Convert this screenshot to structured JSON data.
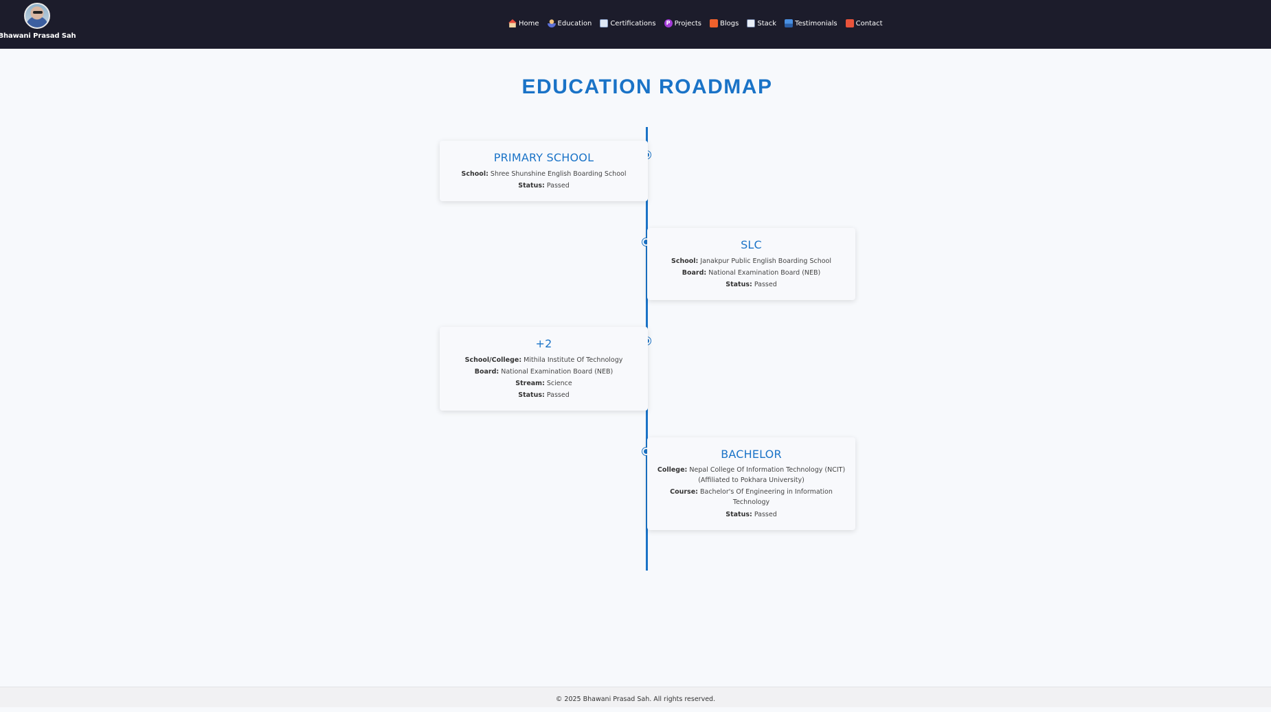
{
  "header": {
    "name": "Bhawani Prasad Sah",
    "nav": [
      {
        "label": "Home",
        "icon": "home-icon"
      },
      {
        "label": "Education",
        "icon": "education-icon"
      },
      {
        "label": "Certifications",
        "icon": "certificate-icon"
      },
      {
        "label": "Projects",
        "icon": "projects-icon"
      },
      {
        "label": "Blogs",
        "icon": "blogs-icon"
      },
      {
        "label": "Stack",
        "icon": "stack-icon"
      },
      {
        "label": "Testimonials",
        "icon": "testimonials-icon"
      },
      {
        "label": "Contact",
        "icon": "contact-icon"
      }
    ]
  },
  "main": {
    "title": "EDUCATION ROADMAP",
    "cards": [
      {
        "title": "PRIMARY SCHOOL",
        "lines": [
          {
            "label": "School:",
            "value": "Shree Shunshine English Boarding School"
          },
          {
            "label": "Status:",
            "value": "Passed"
          }
        ]
      },
      {
        "title": "SLC",
        "lines": [
          {
            "label": "School:",
            "value": "Janakpur Public English Boarding School"
          },
          {
            "label": "Board:",
            "value": "National Examination Board (NEB)"
          },
          {
            "label": "Status:",
            "value": "Passed"
          }
        ]
      },
      {
        "title": "+2",
        "lines": [
          {
            "label": "School/College:",
            "value": "Mithila Institute Of Technology"
          },
          {
            "label": "Board:",
            "value": "National Examination Board (NEB)"
          },
          {
            "label": "Stream:",
            "value": "Science"
          },
          {
            "label": "Status:",
            "value": "Passed"
          }
        ]
      },
      {
        "title": "BACHELOR",
        "lines": [
          {
            "label": "College:",
            "value": "Nepal College Of Information Technology (NCIT) (Affiliated to Pokhara University)"
          },
          {
            "label": "Course:",
            "value": "Bachelor's Of Engineering in Information Technology"
          },
          {
            "label": "Status:",
            "value": "Passed"
          }
        ]
      }
    ]
  },
  "footer": {
    "text": "© 2025 Bhawani Prasad Sah. All rights reserved."
  },
  "colors": {
    "accent": "#1a73c7",
    "header_bg": "#1c1c2b",
    "page_bg": "#f7f9fc"
  }
}
